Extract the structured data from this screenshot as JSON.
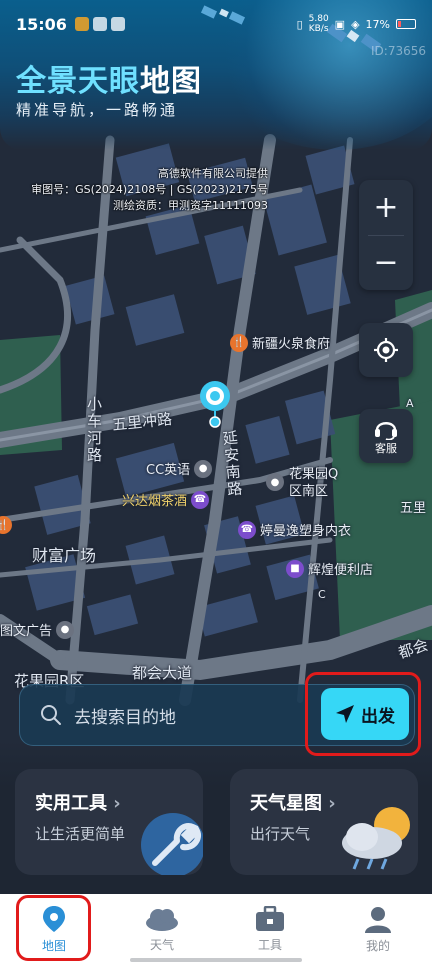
{
  "status_bar": {
    "time": "15:06",
    "net_speed_value": "5.80",
    "net_speed_unit": "KB/s",
    "battery": "17%"
  },
  "header": {
    "id_text": "ID:73656",
    "title_part1": "全景天眼",
    "title_part2": "地图",
    "subtitle": "精准导航，一路畅通"
  },
  "map": {
    "copyright_lines": [
      "高德软件有限公司提供",
      "审图号：GS(2024)2108号 | GS(2023)2175号",
      "测绘资质：甲测资字11111093"
    ],
    "pois": {
      "xinjiang": "新疆火泉食府",
      "cc": "CC英语",
      "xingda": "兴达烟茶酒",
      "tingman": "婷曼逸塑身内衣",
      "huihuang": "辉煌便利店",
      "tuwen": "图文广告"
    },
    "roads": {
      "wulichong": "五里冲路",
      "xiaochehe": "小车河路",
      "yanan_south": "延安南路",
      "duhui": "都会大道",
      "duhui_right": "都会",
      "wuli_right": "五里"
    },
    "areas": {
      "caifu": "财富广场",
      "huaguoyuan_q": "花果园Q区南区",
      "huaguoyuan_r": "花果园R区"
    },
    "letters": {
      "a": "A",
      "c": "C"
    }
  },
  "controls": {
    "zoom_in": "+",
    "zoom_out": "−",
    "service_label": "客服"
  },
  "search": {
    "placeholder": "去搜索目的地",
    "go_label": "出发"
  },
  "cards": [
    {
      "title": "实用工具",
      "subtitle": "让生活更简单"
    },
    {
      "title": "天气星图",
      "subtitle": "出行天气"
    }
  ],
  "tabs": [
    {
      "label": "地图",
      "icon": "map-pin-icon",
      "active": true
    },
    {
      "label": "天气",
      "icon": "cloud-icon",
      "active": false
    },
    {
      "label": "工具",
      "icon": "toolbox-icon",
      "active": false
    },
    {
      "label": "我的",
      "icon": "person-icon",
      "active": false
    }
  ],
  "colors": {
    "accent": "#36d7f6",
    "active_tab": "#2a8fd6",
    "highlight_box": "#e11b1b"
  }
}
